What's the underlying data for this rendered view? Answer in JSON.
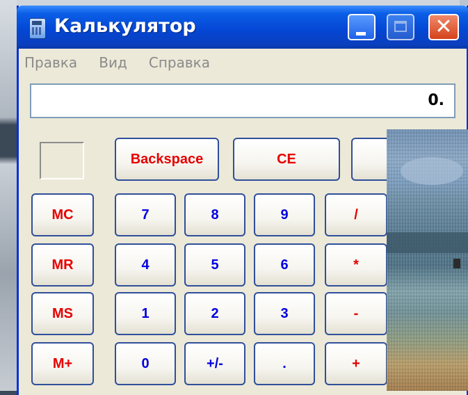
{
  "window": {
    "title": "Калькулятор"
  },
  "menu": [
    "Правка",
    "Вид",
    "Справка"
  ],
  "display": {
    "value": "0."
  },
  "buttons": {
    "backspace": "Backspace",
    "ce": "CE",
    "mc": "MC",
    "mr": "MR",
    "ms": "MS",
    "mplus": "M+",
    "n7": "7",
    "n8": "8",
    "n9": "9",
    "n4": "4",
    "n5": "5",
    "n6": "6",
    "n1": "1",
    "n2": "2",
    "n3": "3",
    "n0": "0",
    "sign": "+/-",
    "dot": ".",
    "div": "/",
    "mul": "*",
    "sub": "-",
    "add": "+"
  },
  "colors": {
    "title_bar": "#0447d6",
    "operator_text": "#e60000",
    "digit_text": "#0000e0",
    "window_face": "#ece9d8"
  }
}
